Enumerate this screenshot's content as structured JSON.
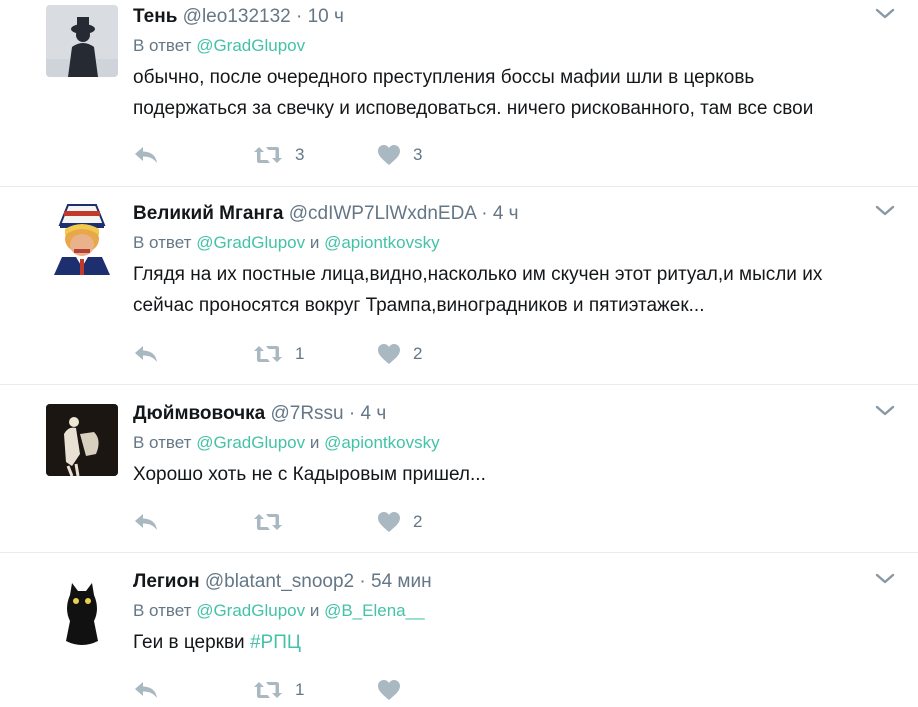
{
  "tweets": [
    {
      "name": "Тень",
      "handle": "@leo132132",
      "dot": "·",
      "time": "10 ч",
      "reply_prefix": "В ответ",
      "reply_user1": "@GradGlupov",
      "reply_and": "",
      "reply_user2": "",
      "text_line1": "обычно, после очередного преступления боссы мафии шли в церковь",
      "text_line2": "подержаться за свечку и исповедоваться. ничего рискованного, там все свои",
      "retweets": "3",
      "likes": "3",
      "avatar_color": "#3a3f47"
    },
    {
      "name": "Великий Мганга",
      "handle": "@cdIWP7LlWxdnEDA",
      "dot": "·",
      "time": "4 ч",
      "reply_prefix": "В ответ",
      "reply_user1": "@GradGlupov",
      "reply_and": "и",
      "reply_user2": "@apiontkovsky",
      "text_line1": "Глядя на их постные лица,видно,насколько им скучен этот ритуал,и мысли их",
      "text_line2": "сейчас проносятся вокруг Трампа,виноградников и пятиэтажек...",
      "retweets": "1",
      "likes": "2",
      "avatar_color": "#c9863a"
    },
    {
      "name": "Дюймвовочка",
      "handle": "@7Rssu",
      "dot": "·",
      "time": "4 ч",
      "reply_prefix": "В ответ",
      "reply_user1": "@GradGlupov",
      "reply_and": "и",
      "reply_user2": "@apiontkovsky",
      "text_line1": "Хорошо хоть не с Кадыровым пришел...",
      "text_line2": "",
      "retweets": "",
      "likes": "2",
      "avatar_color": "#1b1612"
    },
    {
      "name": "Легион",
      "handle": "@blatant_snoop2",
      "dot": "·",
      "time": "54 мин",
      "reply_prefix": "В ответ",
      "reply_user1": "@GradGlupov",
      "reply_and": "и",
      "reply_user2": "@B_Elena__",
      "text_line1_plain": "Геи в церкви",
      "text_line1_hashtag": "#РПЦ",
      "retweets": "1",
      "likes": "",
      "avatar_color": "#111111"
    }
  ],
  "colors": {
    "link": "#44c2a8",
    "muted": "#657786",
    "icon": "#aab8c2",
    "divider": "#e6ecf0"
  },
  "icons": [
    "reply-icon",
    "retweet-icon",
    "like-icon",
    "chevron-down-icon"
  ]
}
